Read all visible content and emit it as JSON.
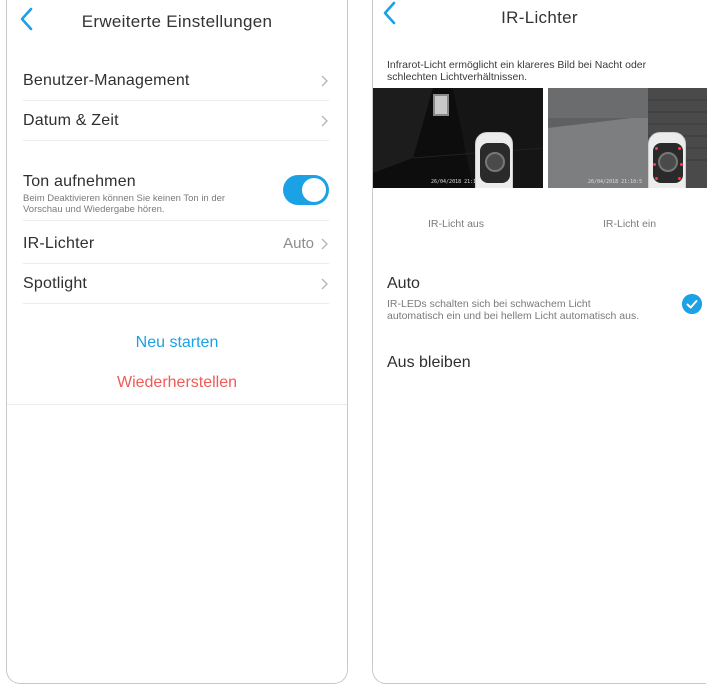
{
  "left": {
    "title": "Erweiterte Einstellungen",
    "rows": [
      {
        "label": "Benutzer-Management"
      },
      {
        "label": "Datum & Zeit"
      }
    ],
    "sound": {
      "label": "Ton aufnehmen",
      "description": "Beim Deaktivieren können Sie keinen Ton in der Vorschau und Wiedergabe hören.",
      "enabled": true
    },
    "ir": {
      "label": "IR-Lichter",
      "value": "Auto"
    },
    "spotlight": {
      "label": "Spotlight"
    },
    "restart_label": "Neu starten",
    "reset_label": "Wiederherstellen"
  },
  "right": {
    "title": "IR-Lichter",
    "intro": "Infrarot-Licht ermöglicht ein klareres Bild bei Nacht oder schlechten Lichtverhältnissen.",
    "captions": {
      "off": "IR-Licht aus",
      "on": "IR-Licht ein"
    },
    "stamp": "26/04/2018 21:10:5",
    "options": [
      {
        "label": "Auto",
        "description": "IR-LEDs schalten sich bei schwachem Licht automatisch ein und bei hellem Licht automatisch aus.",
        "selected": true
      },
      {
        "label": "Aus bleiben",
        "selected": false
      }
    ]
  },
  "colors": {
    "accent": "#1aa1e6",
    "danger": "#f05a58",
    "divider": "#ececec"
  }
}
